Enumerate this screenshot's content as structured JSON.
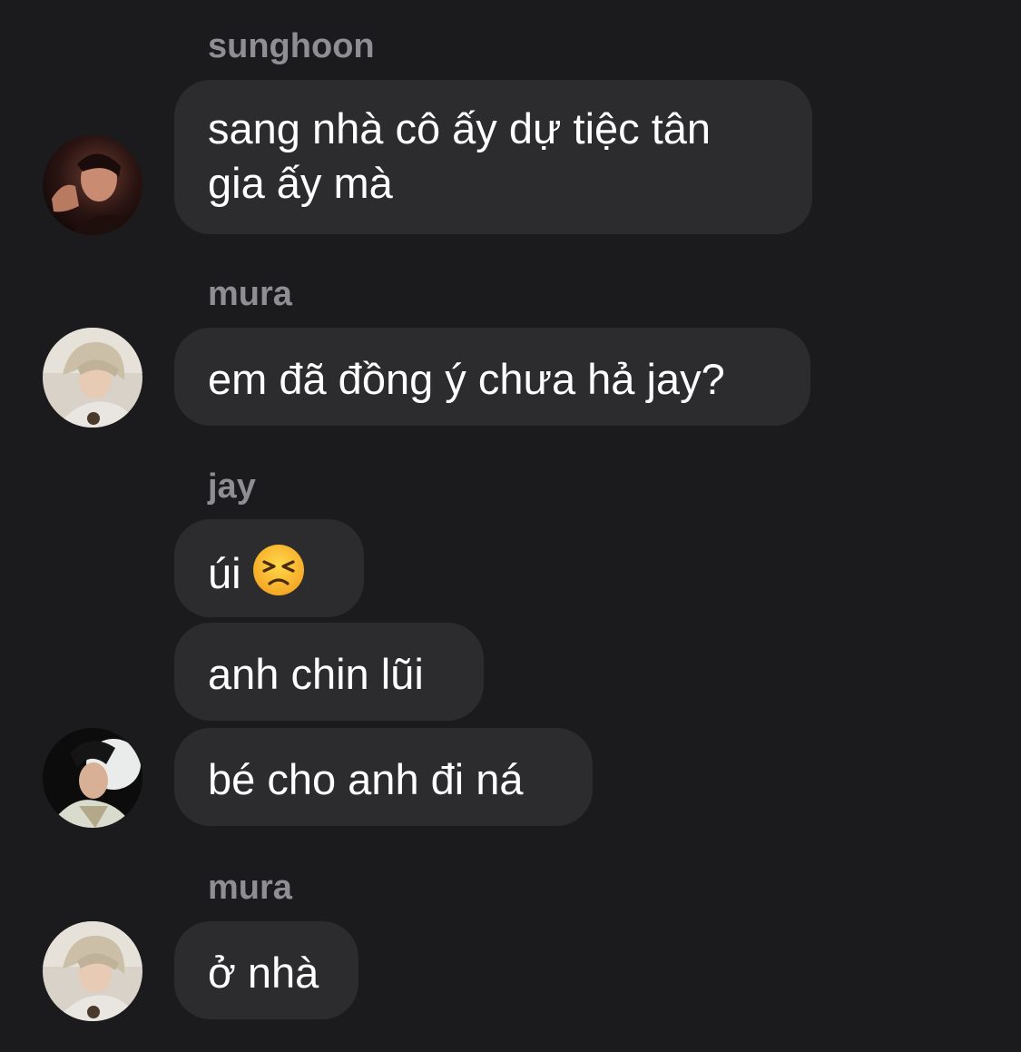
{
  "conversation": {
    "groups": [
      {
        "sender": "sunghoon",
        "avatar": "sunghoon-avatar",
        "messages": [
          "sang nhà cô ấy dự tiệc tân",
          "gia ấy mà"
        ]
      },
      {
        "sender": "mura",
        "avatar": "mura-avatar",
        "messages": [
          "em đã đồng ý chưa hả jay?"
        ]
      },
      {
        "sender": "jay",
        "avatar": "jay-avatar",
        "messages": [
          "úi",
          "anh chin lũi",
          "bé cho anh đi ná"
        ],
        "emoji": "persevering-face-emoji"
      },
      {
        "sender": "mura",
        "avatar": "mura-avatar",
        "messages": [
          "ở nhà"
        ]
      }
    ]
  },
  "colors": {
    "background": "#1b1b1d",
    "bubble": "#2c2c2e",
    "sender_name": "#8e8e93",
    "message_text": "#ffffff"
  }
}
